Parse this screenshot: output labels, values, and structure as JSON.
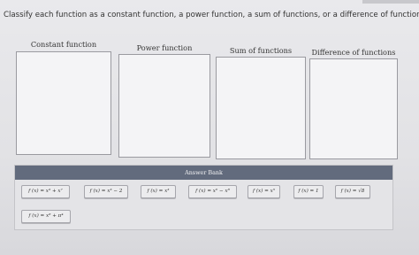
{
  "question": {
    "text": "Classify each function as a constant function, a power function, a sum of functions, or a difference of functions."
  },
  "categories": [
    {
      "label": "Constant function"
    },
    {
      "label": "Power function"
    },
    {
      "label": "Sum of functions"
    },
    {
      "label": "Difference of functions"
    }
  ],
  "answer_bank": {
    "title": "Answer Bank",
    "items": [
      "f (x) = x³ + x⁷",
      "f (x) = x³ − 2",
      "f (x) = x³",
      "f (x) = x⁶ − x⁸",
      "f (x) = x⁵",
      "f (x) = 1",
      "f (x) = √8",
      "f (x) = x⁸ + π⁴"
    ]
  }
}
